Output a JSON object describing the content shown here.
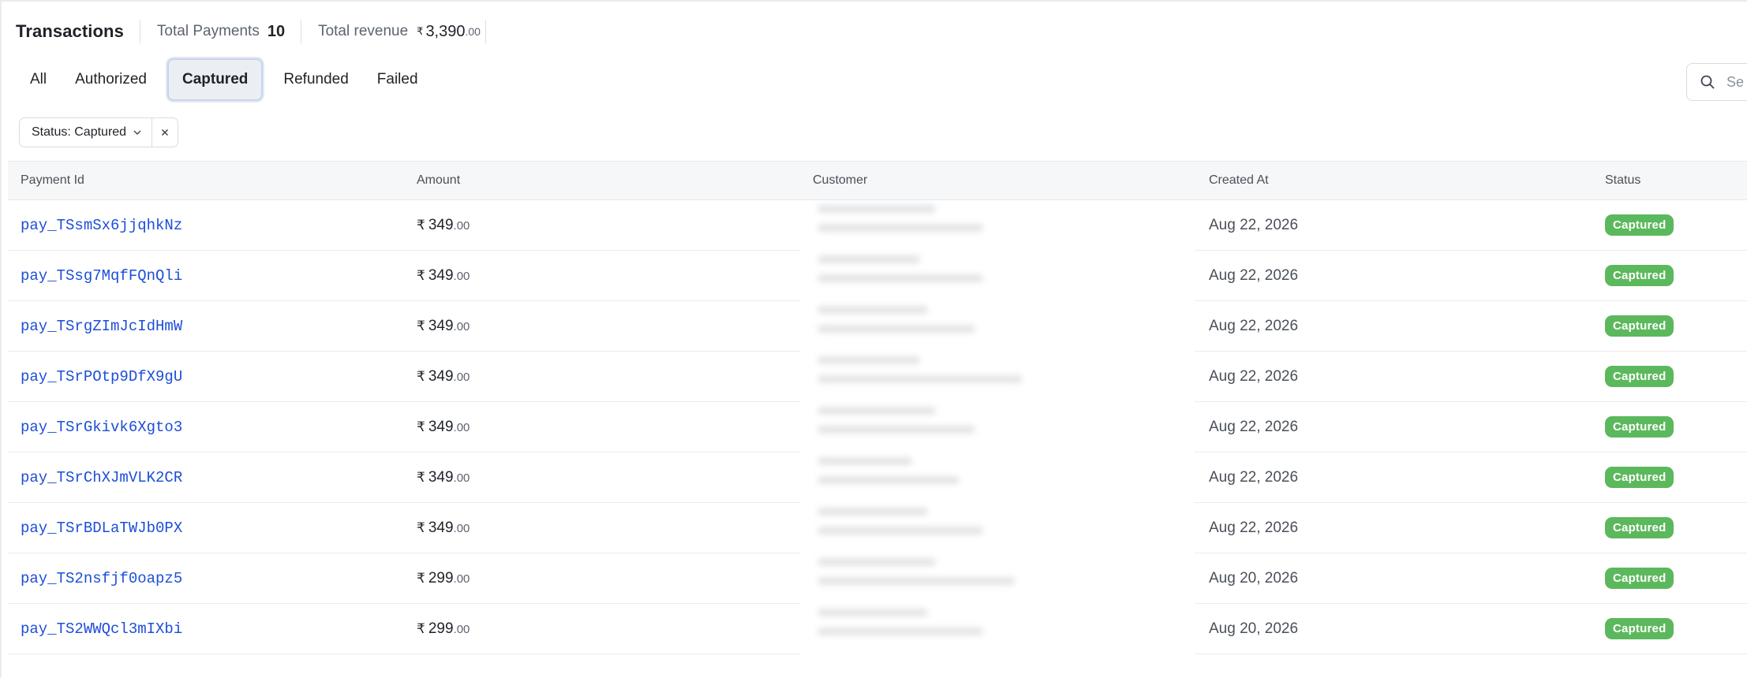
{
  "header": {
    "title": "Transactions",
    "total_payments_label": "Total Payments",
    "total_payments_value": "10",
    "total_revenue_label": "Total revenue",
    "total_revenue_currency": "₹",
    "total_revenue_int": "3,390",
    "total_revenue_dec": ".00"
  },
  "tabs": [
    {
      "label": "All",
      "active": false
    },
    {
      "label": "Authorized",
      "active": false
    },
    {
      "label": "Captured",
      "active": true
    },
    {
      "label": "Refunded",
      "active": false
    },
    {
      "label": "Failed",
      "active": false
    }
  ],
  "search": {
    "placeholder": "Se",
    "icon": "search-icon"
  },
  "filter_chip": {
    "label": "Status: Captured",
    "icons": [
      "chevron-down-icon",
      "close-icon"
    ]
  },
  "table": {
    "columns": [
      "Payment Id",
      "Amount",
      "Customer",
      "Created At",
      "Status"
    ],
    "rows": [
      {
        "payment_id": "pay_TSsmSx6jjqhkNz",
        "currency": "₹",
        "amount_int": "349",
        "amount_dec": ".00",
        "created_at": "Aug 22, 2026",
        "status": "Captured"
      },
      {
        "payment_id": "pay_TSsg7MqfFQnQli",
        "currency": "₹",
        "amount_int": "349",
        "amount_dec": ".00",
        "created_at": "Aug 22, 2026",
        "status": "Captured"
      },
      {
        "payment_id": "pay_TSrgZImJcIdHmW",
        "currency": "₹",
        "amount_int": "349",
        "amount_dec": ".00",
        "created_at": "Aug 22, 2026",
        "status": "Captured"
      },
      {
        "payment_id": "pay_TSrPOtp9DfX9gU",
        "currency": "₹",
        "amount_int": "349",
        "amount_dec": ".00",
        "created_at": "Aug 22, 2026",
        "status": "Captured"
      },
      {
        "payment_id": "pay_TSrGkivk6Xgto3",
        "currency": "₹",
        "amount_int": "349",
        "amount_dec": ".00",
        "created_at": "Aug 22, 2026",
        "status": "Captured"
      },
      {
        "payment_id": "pay_TSrChXJmVLK2CR",
        "currency": "₹",
        "amount_int": "349",
        "amount_dec": ".00",
        "created_at": "Aug 22, 2026",
        "status": "Captured"
      },
      {
        "payment_id": "pay_TSrBDLaTWJb0PX",
        "currency": "₹",
        "amount_int": "349",
        "amount_dec": ".00",
        "created_at": "Aug 22, 2026",
        "status": "Captured"
      },
      {
        "payment_id": "pay_TS2nsfjf0oapz5",
        "currency": "₹",
        "amount_int": "299",
        "amount_dec": ".00",
        "created_at": "Aug 20, 2026",
        "status": "Captured"
      },
      {
        "payment_id": "pay_TS2WWQcl3mIXbi",
        "currency": "₹",
        "amount_int": "299",
        "amount_dec": ".00",
        "created_at": "Aug 20, 2026",
        "status": "Captured"
      }
    ]
  },
  "colors": {
    "status_captured": "#5cb85c",
    "link": "#1d4ed8",
    "active_tab_bg": "#ebeef3"
  }
}
